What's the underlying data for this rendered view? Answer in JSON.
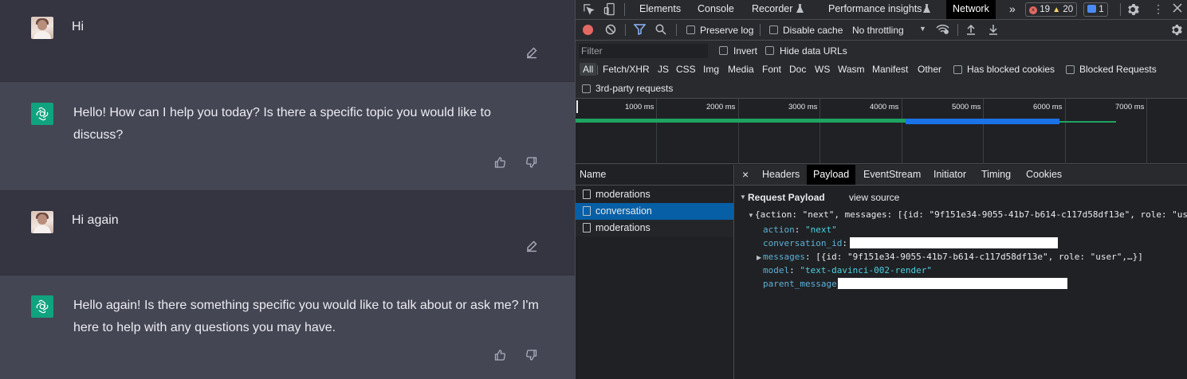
{
  "chat": {
    "messages": [
      {
        "role": "user",
        "text": "Hi"
      },
      {
        "role": "assistant",
        "text": "Hello! How can I help you today? Is there a specific topic you would like to discuss?"
      },
      {
        "role": "user",
        "text": "Hi again"
      },
      {
        "role": "assistant",
        "text": "Hello again! Is there something specific you would like to talk about or ask me? I'm here to help with any questions you may have."
      }
    ]
  },
  "devtools": {
    "tabs": [
      "Elements",
      "Console",
      "Recorder",
      "Performance insights",
      "Network"
    ],
    "active_tab": "Network",
    "more_tabs": "»",
    "errors_count": "19",
    "warnings_count": "20",
    "info_count": "1",
    "toolbar": {
      "preserve_log": "Preserve log",
      "disable_cache": "Disable cache",
      "throttling": "No throttling"
    },
    "filter": {
      "placeholder": "Filter",
      "invert": "Invert",
      "hide_data_urls": "Hide data URLs",
      "types": [
        "All",
        "Fetch/XHR",
        "JS",
        "CSS",
        "Img",
        "Media",
        "Font",
        "Doc",
        "WS",
        "Wasm",
        "Manifest",
        "Other"
      ],
      "has_blocked_cookies": "Has blocked cookies",
      "blocked_requests": "Blocked Requests",
      "third_party": "3rd-party requests"
    },
    "timeline_ticks": [
      "1000 ms",
      "2000 ms",
      "3000 ms",
      "4000 ms",
      "5000 ms",
      "6000 ms",
      "7000 ms"
    ],
    "requests": {
      "header": "Name",
      "items": [
        "moderations",
        "conversation",
        "moderations"
      ]
    },
    "details": {
      "tabs": [
        "Headers",
        "Payload",
        "EventStream",
        "Initiator",
        "Timing",
        "Cookies"
      ],
      "active_tab": "Payload",
      "close": "×",
      "section_title": "Request Payload",
      "view_source": "view source",
      "summary": "{action: \"next\", messages: [{id: \"9f151e34-9055-41b7-b614-c117d58df13e\", role: \"us",
      "fields": {
        "action_key": "action",
        "action_val": "\"next\"",
        "conversation_key": "conversation_id",
        "messages_key": "messages",
        "messages_val": "[{id: \"9f151e34-9055-41b7-b614-c117d58df13e\", role: \"user\",…}]",
        "model_key": "model",
        "model_val": "\"text-davinci-002-render\"",
        "parent_key": "parent_message_id"
      }
    }
  },
  "colors": {
    "chat_user_bg": "#343541",
    "chat_bot_bg": "#444654",
    "openai_green": "#10a37f",
    "selected_row": "#075fa6"
  }
}
